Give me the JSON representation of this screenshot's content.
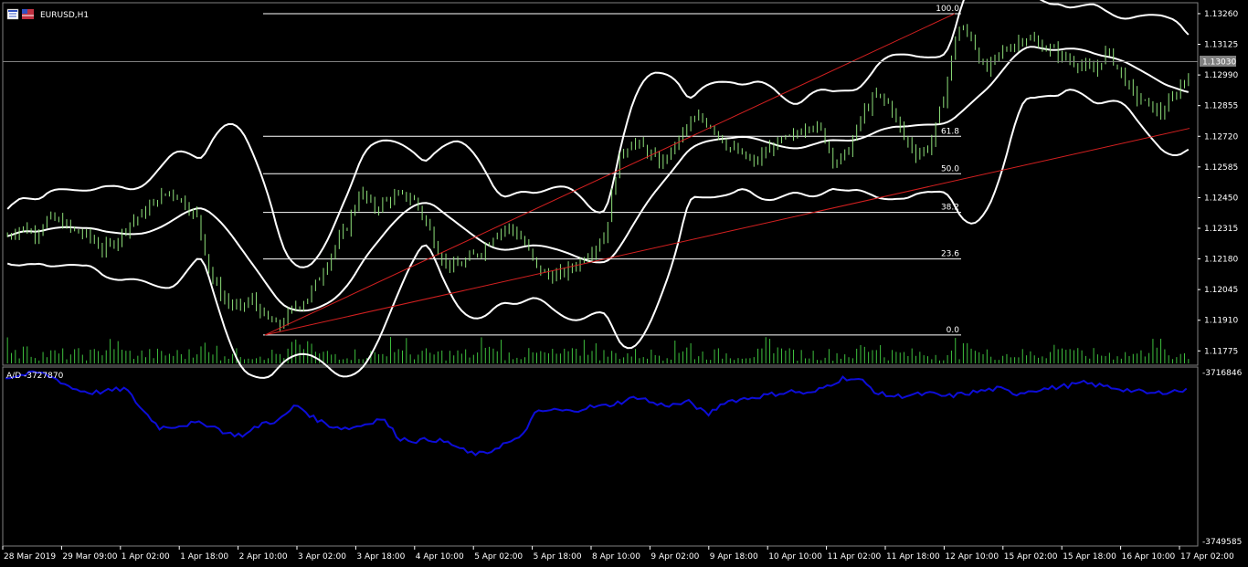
{
  "main_chart": {
    "symbol_label": "EURUSD,H1",
    "current_price": "1.13030",
    "price_ticks": [
      "1.13260",
      "1.13125",
      "1.12990",
      "1.12855",
      "1.12720",
      "1.12585",
      "1.12450",
      "1.12315",
      "1.12180",
      "1.12045",
      "1.11910",
      "1.11775"
    ],
    "fib_levels": [
      {
        "label": "100.0",
        "price": 1.1326
      },
      {
        "label": "61.8",
        "price": 1.1272
      },
      {
        "label": "50.0",
        "price": 1.12555
      },
      {
        "label": "38.2",
        "price": 1.12385
      },
      {
        "label": "23.6",
        "price": 1.1218
      },
      {
        "label": "0.0",
        "price": 1.11845
      }
    ],
    "price_range": [
      1.1172,
      1.133
    ]
  },
  "indicator": {
    "label": "A/D -3727870",
    "max_label": "-3716846",
    "min_label": "-3749585"
  },
  "time_axis": {
    "labels": [
      "28 Mar 2019",
      "29 Mar 09:00",
      "1 Apr 02:00",
      "1 Apr 18:00",
      "2 Apr 10:00",
      "3 Apr 02:00",
      "3 Apr 18:00",
      "4 Apr 10:00",
      "5 Apr 02:00",
      "5 Apr 18:00",
      "8 Apr 10:00",
      "9 Apr 02:00",
      "9 Apr 18:00",
      "10 Apr 10:00",
      "11 Apr 02:00",
      "11 Apr 18:00",
      "12 Apr 10:00",
      "15 Apr 02:00",
      "15 Apr 18:00",
      "16 Apr 10:00",
      "17 Apr 02:00"
    ]
  },
  "colors": {
    "background": "#000000",
    "candles": "#8ee07a",
    "bands": "#ffffff",
    "trendlines": "#d42020",
    "fib": "#ffffff",
    "volume": "#3ec03e",
    "ad_line": "#0d0dd8",
    "grid": "#808080"
  },
  "chart_data": [
    {
      "type": "line",
      "title": "",
      "series": [
        {
          "name": "EURUSD,H1",
          "values": [
            1.1228,
            1.1232,
            1.1229,
            1.1236,
            1.1234,
            1.123,
            1.1228,
            1.1222,
            1.1226,
            1.1234,
            1.1238,
            1.1244,
            1.1248,
            1.1243,
            1.1236,
            1.121,
            1.12,
            1.1196,
            1.12,
            1.1192,
            1.1188,
            1.1196,
            1.12,
            1.121,
            1.1222,
            1.1232,
            1.1248,
            1.124,
            1.1244,
            1.1246,
            1.1244,
            1.1232,
            1.1218,
            1.1214,
            1.1218,
            1.1222,
            1.123,
            1.1232,
            1.1226,
            1.1214,
            1.121,
            1.1212,
            1.1216,
            1.1222,
            1.1228,
            1.1262,
            1.127,
            1.1266,
            1.126,
            1.1266,
            1.1276,
            1.128,
            1.1276,
            1.1268,
            1.1264,
            1.126,
            1.1266,
            1.127,
            1.1272,
            1.1278,
            1.1274,
            1.126,
            1.1266,
            1.1282,
            1.129,
            1.1286,
            1.1272,
            1.1264,
            1.1268,
            1.129,
            1.132,
            1.1316,
            1.13,
            1.1308,
            1.1312,
            1.1316,
            1.1312,
            1.131,
            1.1306,
            1.1304,
            1.13,
            1.131,
            1.13,
            1.129,
            1.1286,
            1.1282,
            1.129,
            1.13
          ]
        }
      ],
      "ylim": [
        1.1172,
        1.133
      ]
    },
    {
      "type": "line",
      "title": "",
      "series": [
        {
          "name": "A/D",
          "values": [
            -3718500,
            -3718000,
            -3717500,
            -3718800,
            -3720600,
            -3721300,
            -3721000,
            -3720500,
            -3724500,
            -3727800,
            -3727500,
            -3727000,
            -3727300,
            -3729000,
            -3729200,
            -3727000,
            -3726500,
            -3723500,
            -3726000,
            -3727500,
            -3728000,
            -3727200,
            -3726000,
            -3729800,
            -3730300,
            -3730000,
            -3730800,
            -3732500,
            -3732800,
            -3731000,
            -3730000,
            -3725000,
            -3724500,
            -3724800,
            -3724000,
            -3723800,
            -3723000,
            -3722000,
            -3723500,
            -3723600,
            -3723000,
            -3725500,
            -3723000,
            -3722500,
            -3722000,
            -3721500,
            -3721000,
            -3721600,
            -3720000,
            -3718500,
            -3719000,
            -3721500,
            -3722000,
            -3721700,
            -3721500,
            -3722000,
            -3721500,
            -3721000,
            -3720500,
            -3721500,
            -3720800,
            -3720500,
            -3720000,
            -3719500,
            -3720000,
            -3720500,
            -3721000,
            -3721500,
            -3721000,
            -3720900
          ]
        }
      ],
      "ylim": [
        -3749585,
        -3716846
      ]
    }
  ]
}
